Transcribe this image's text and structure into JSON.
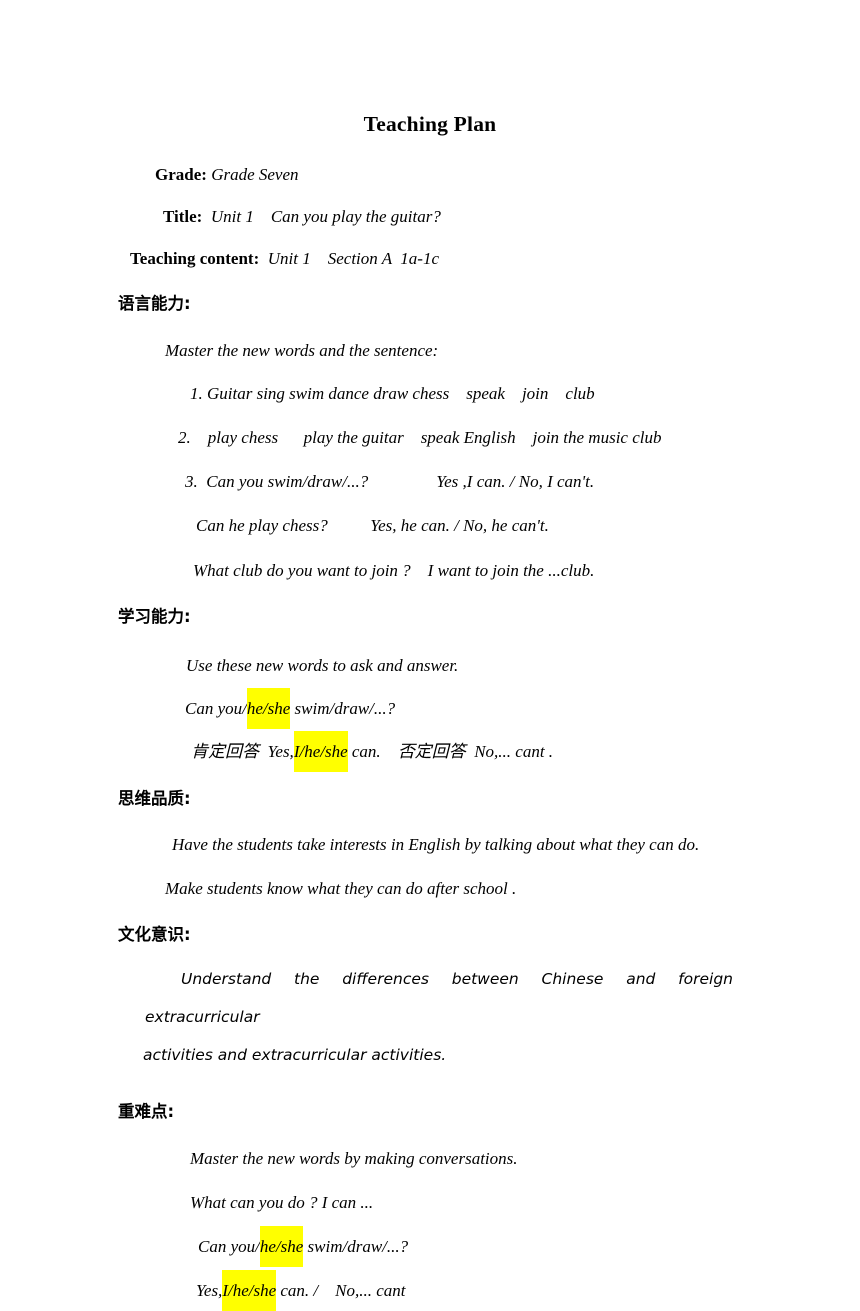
{
  "document": {
    "title": "Teaching Plan",
    "highlight_color": "#ffff00",
    "text_color": "#000000",
    "background_color": "#ffffff"
  },
  "meta": {
    "grade": {
      "label": "Grade:",
      "value": "Grade Seven"
    },
    "title": {
      "label": "Title:",
      "value": "Unit 1    Can you play the guitar?"
    },
    "teaching_content": {
      "label": "Teaching content:",
      "value": "Unit 1    Section A  1a-1c"
    }
  },
  "sections": {
    "language_ability": {
      "heading": "语言能力:",
      "intro": "Master the new words and the sentence:",
      "item1": "1. Guitar sing swim dance draw chess    speak    join    club",
      "item2": "2.    play chess      play the guitar    speak English    join the music club",
      "item3": "3.  Can you swim/draw/...?                Yes ,I can. / No, I can't.",
      "item3b": "Can he play chess?          Yes, he can. / No, he can't.",
      "item3c": "What club do you want to join ?    I want to join the ...club."
    },
    "learning_ability": {
      "heading": "学习能力:",
      "intro": "Use these new words to ask and answer.",
      "question": {
        "before": "Can you/",
        "highlight": "he/she",
        "after": " swim/draw/...?"
      },
      "answers": {
        "affirm_label": "肯定回答",
        "affirm_before": "  Yes,",
        "affirm_highlight": "I/he/she",
        "affirm_after": " can.    ",
        "negative_label": "否定回答",
        "negative_text": "  No,... cant ."
      }
    },
    "thinking_quality": {
      "heading": "思维品质:",
      "line1": "Have the students take interests in English by talking about what they can do.",
      "line2": "Make students know what they can do after school ."
    },
    "cultural_awareness": {
      "heading": "文化意识:",
      "paragraph_line1": "Understand the differences between Chinese and foreign extracurricular",
      "paragraph_line2": "activities and extracurricular activities."
    },
    "key_points": {
      "heading": "重难点:",
      "line1": "Master the new words by making conversations.",
      "line2": "What can you do ? I can ...",
      "question": {
        "before": "Can you/",
        "highlight": "he/she",
        "after": " swim/draw/...?"
      },
      "answer": {
        "before": "Yes,",
        "highlight": "I/he/she",
        "after": " can. /    No,... cant"
      }
    }
  }
}
